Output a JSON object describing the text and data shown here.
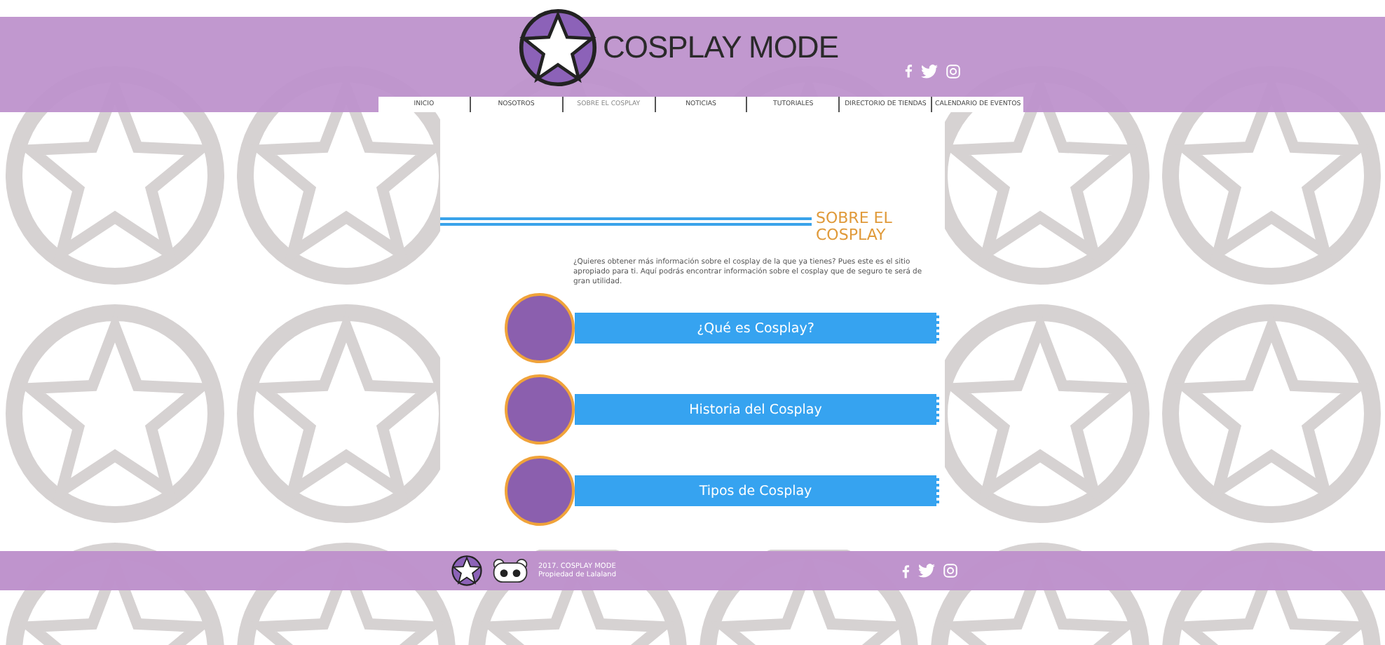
{
  "header": {
    "logo_text": "COSPLAY MODE"
  },
  "nav": [
    {
      "label": "INICIO",
      "selected": false
    },
    {
      "label": "NOSOTROS",
      "selected": false
    },
    {
      "label": "SOBRE EL COSPLAY",
      "selected": true
    },
    {
      "label": "NOTICIAS",
      "selected": false
    },
    {
      "label": "TUTORIALES",
      "selected": false
    },
    {
      "label": "DIRECTORIO DE TIENDAS",
      "selected": false
    },
    {
      "label": "CALENDARIO DE EVENTOS",
      "selected": false
    }
  ],
  "section": {
    "title": "SOBRE EL COSPLAY",
    "intro": "¿Quieres obtener más información sobre el cosplay de la que ya tienes? Pues este es el sitio apropiado para ti. Aquí podrás encontrar información sobre el cosplay que de seguro te será de gran utilidad."
  },
  "links": [
    {
      "label": "¿Qué es Cosplay?"
    },
    {
      "label": "Historia del Cosplay"
    },
    {
      "label": "Tipos de Cosplay"
    }
  ],
  "footer": {
    "line_1": "2017. COSPLAY MODE",
    "line_2": "Propiedad de Lalaland"
  }
}
